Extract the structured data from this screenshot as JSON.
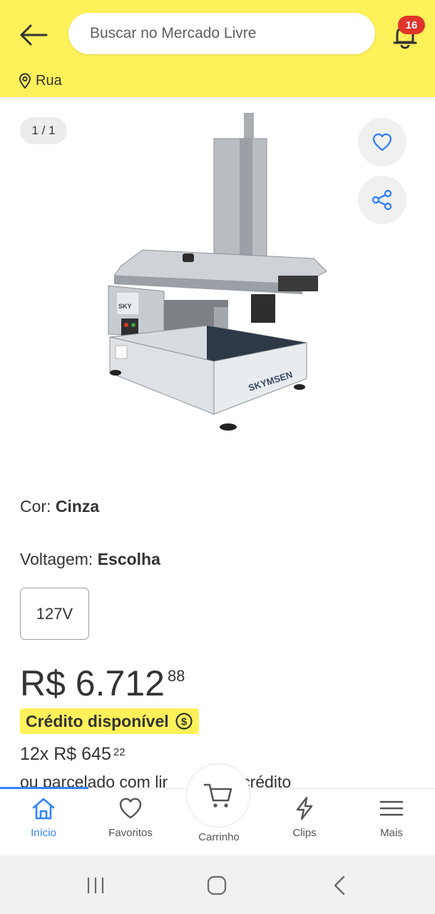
{
  "header": {
    "search_placeholder": "Buscar no Mercado Livre",
    "notification_count": "16",
    "location_label": "Rua",
    "accent_color": "#fff159"
  },
  "gallery": {
    "counter": "1 / 1",
    "brand_on_product": "SKYMSEN"
  },
  "variations": {
    "color_label": "Cor: ",
    "color_value": "Cinza",
    "voltage_label": "Voltagem: ",
    "voltage_value": "Escolha",
    "voltage_options": [
      "127V"
    ]
  },
  "price": {
    "main": "R$ 6.712",
    "cents": "88"
  },
  "credit": {
    "badge_label": "Crédito disponível"
  },
  "installment": {
    "main": "12x R$ 645",
    "cents": "22",
    "note": "ou parcelado com lir"
  },
  "installment_note_tail": "crédito",
  "bottom_nav": {
    "items": [
      {
        "label": "Início",
        "icon": "home-icon"
      },
      {
        "label": "Favoritos",
        "icon": "heart-icon"
      },
      {
        "label": "Carrinho",
        "icon": "cart-icon"
      },
      {
        "label": "Clips",
        "icon": "lightning-icon"
      },
      {
        "label": "Mais",
        "icon": "menu-icon"
      }
    ],
    "active_color": "#3483fa"
  }
}
